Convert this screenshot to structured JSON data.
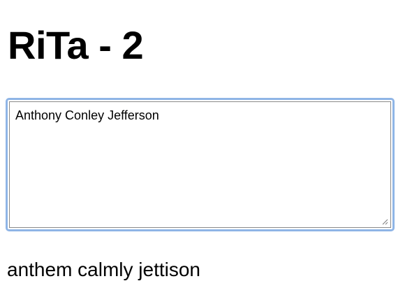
{
  "page": {
    "title": "RiTa - 2"
  },
  "input": {
    "value": "Anthony Conley Jefferson"
  },
  "output": {
    "text": "anthem calmly jettison"
  },
  "colors": {
    "focus_ring": "#8fb5e6",
    "field_border": "#8a8a8a",
    "background": "#ffffff",
    "text": "#000000"
  },
  "icons": {
    "resize": "resize-grip-icon"
  }
}
